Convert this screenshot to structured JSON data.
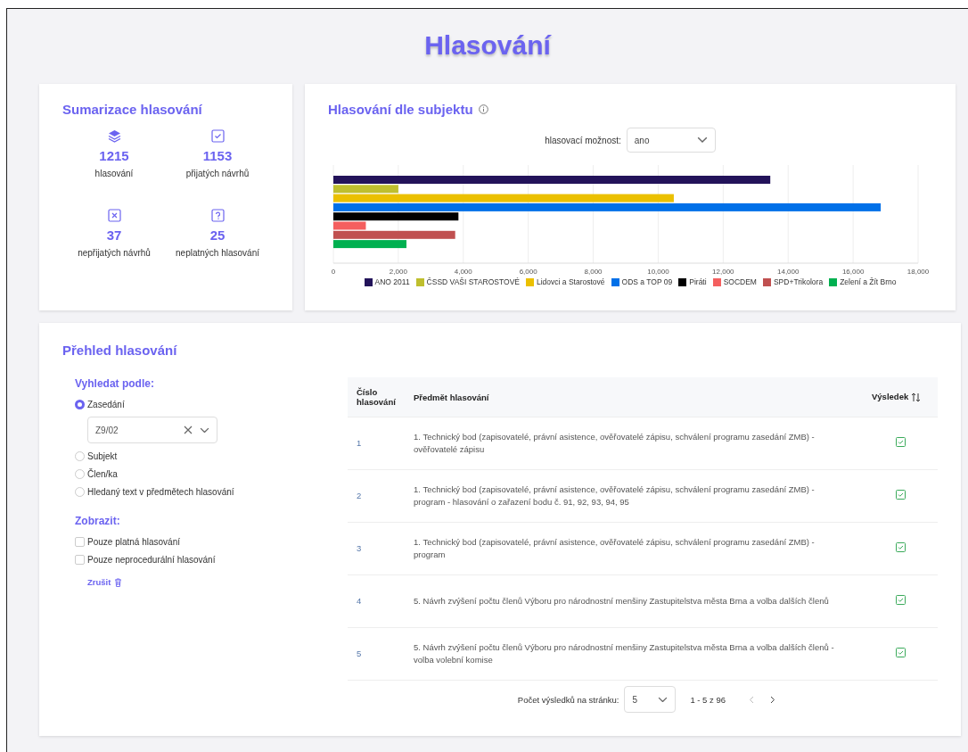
{
  "page_title": "Hlasování",
  "summary": {
    "title": "Sumarizace hlasování",
    "stats": [
      {
        "kind": "layers",
        "value": "1215",
        "label": "hlasování"
      },
      {
        "kind": "check",
        "value": "1153",
        "label": "přijatých návrhů"
      },
      {
        "kind": "cross",
        "value": "37",
        "label": "nepřijatých návrhů"
      },
      {
        "kind": "question",
        "value": "25",
        "label": "neplatných hlasování"
      }
    ]
  },
  "by_subject": {
    "title": "Hlasování dle subjektu",
    "option_label": "hlasovací možnost:",
    "option_value": "ano",
    "chart_data": {
      "type": "bar",
      "orientation": "horizontal",
      "grid": true,
      "xlim": [
        0,
        18000
      ],
      "xticks": [
        {
          "value": 0,
          "label": "0"
        },
        {
          "value": 2000,
          "label": "2,000"
        },
        {
          "value": 4000,
          "label": "4,000"
        },
        {
          "value": 6000,
          "label": "6,000"
        },
        {
          "value": 8000,
          "label": "8,000"
        },
        {
          "value": 10000,
          "label": "10,000"
        },
        {
          "value": 12000,
          "label": "12,000"
        },
        {
          "value": 14000,
          "label": "14,000"
        },
        {
          "value": 16000,
          "label": "16,000"
        },
        {
          "value": 18000,
          "label": "18,000"
        }
      ],
      "series": [
        {
          "name": "ANO 2011",
          "color": "#23135a",
          "values": [
            13450
          ]
        },
        {
          "name": "ČSSD VAŠI STAROSTOVÉ",
          "color": "#bfbf2e",
          "values": [
            2000
          ]
        },
        {
          "name": "Lidovci a Starostové",
          "color": "#ebc000",
          "values": [
            10480
          ]
        },
        {
          "name": "ODS a TOP 09",
          "color": "#0070e8",
          "values": [
            16850
          ]
        },
        {
          "name": "Piráti",
          "color": "#000000",
          "values": [
            3850
          ]
        },
        {
          "name": "SOCDEM",
          "color": "#f45f5f",
          "values": [
            1000
          ]
        },
        {
          "name": "SPD+Trikolora",
          "color": "#c05050",
          "values": [
            3750
          ]
        },
        {
          "name": "Zelení a Žít Brno",
          "color": "#00b050",
          "values": [
            2250
          ]
        }
      ]
    }
  },
  "overview": {
    "title": "Přehled hlasování",
    "search_heading": "Vyhledat podle:",
    "search_options": [
      {
        "label": "Zasedání",
        "selected": true
      },
      {
        "label": "Subjekt",
        "selected": false
      },
      {
        "label": "Člen/ka",
        "selected": false
      },
      {
        "label": "Hledaný text v předmětech hlasování",
        "selected": false
      }
    ],
    "session_value": "Z9/02",
    "show_heading": "Zobrazit:",
    "show_options": [
      {
        "label": "Pouze platná hlasování",
        "checked": false
      },
      {
        "label": "Pouze neprocedurální hlasování",
        "checked": false
      }
    ],
    "cancel": "Zrušit",
    "table": {
      "columns": [
        "Číslo hlasování",
        "Předmět hlasování",
        "Výsledek"
      ],
      "rows": [
        {
          "number": "1",
          "subject": "1. Technický bod (zapisovatelé, právní asistence, ověřovatelé zápisu, schválení programu zasedání ZMB) - ověřovatelé zápisu",
          "passed": true
        },
        {
          "number": "2",
          "subject": "1. Technický bod (zapisovatelé, právní asistence, ověřovatelé zápisu, schválení programu zasedání ZMB) - program - hlasování o zařazení bodu č. 91, 92, 93, 94, 95",
          "passed": true
        },
        {
          "number": "3",
          "subject": "1. Technický bod (zapisovatelé, právní asistence, ověřovatelé zápisu, schválení programu zasedání ZMB) - program",
          "passed": true
        },
        {
          "number": "4",
          "subject": "5. Návrh zvýšení počtu členů Výboru pro národnostní menšiny Zastupitelstva města Brna a volba dalších členů",
          "passed": true
        },
        {
          "number": "5",
          "subject": "5. Návrh zvýšení počtu členů Výboru pro národnostní menšiny Zastupitelstva města Brna a volba dalších členů - volba volební komise",
          "passed": true
        }
      ]
    },
    "pagination": {
      "per_page_label": "Počet výsledků na stránku:",
      "per_page_value": "5",
      "range": "1 - 5 z 96"
    }
  }
}
